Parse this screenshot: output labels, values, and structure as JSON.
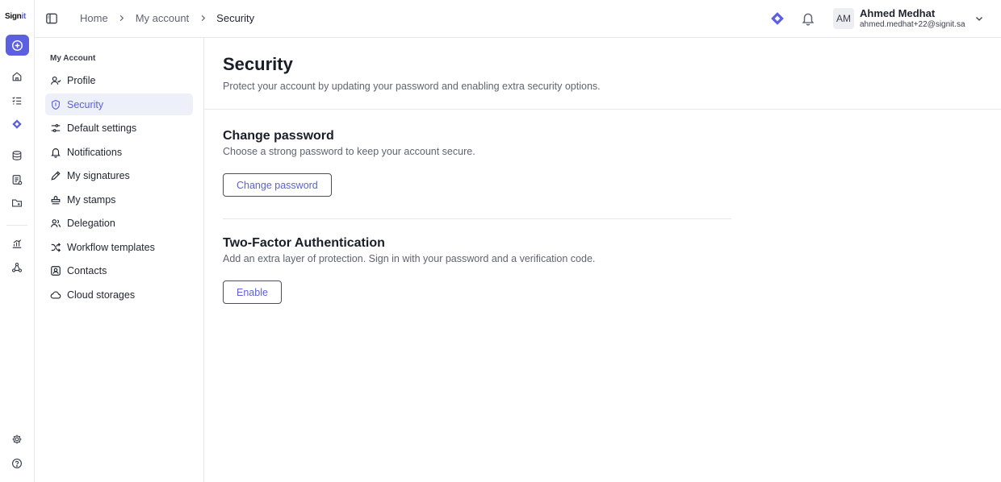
{
  "app": {
    "logo_text": "Sign",
    "logo_suffix": "it"
  },
  "rail": {
    "items": [
      {
        "icon": "plus-circle-icon"
      },
      {
        "icon": "home-icon"
      },
      {
        "icon": "task-list-icon"
      },
      {
        "icon": "diamond-icon"
      },
      {
        "icon": "archive-icon"
      },
      {
        "icon": "document-list-icon"
      },
      {
        "icon": "folder-share-icon"
      },
      {
        "icon": "analytics-icon"
      },
      {
        "icon": "workflow-icon"
      },
      {
        "icon": "settings-icon"
      },
      {
        "icon": "help-icon"
      }
    ]
  },
  "header": {
    "breadcrumbs": [
      "Home",
      "My account",
      "Security"
    ]
  },
  "user": {
    "initials": "AM",
    "name": "Ahmed Medhat",
    "email": "ahmed.medhat+22@signit.sa"
  },
  "account_nav": {
    "heading": "My Account",
    "items": [
      {
        "label": "Profile",
        "icon": "user-icon"
      },
      {
        "label": "Security",
        "icon": "shield-icon",
        "active": true
      },
      {
        "label": "Default settings",
        "icon": "sliders-icon"
      },
      {
        "label": "Notifications",
        "icon": "bell-icon"
      },
      {
        "label": "My signatures",
        "icon": "pen-icon"
      },
      {
        "label": "My stamps",
        "icon": "stamp-icon"
      },
      {
        "label": "Delegation",
        "icon": "users-icon"
      },
      {
        "label": "Workflow templates",
        "icon": "shuffle-icon"
      },
      {
        "label": "Contacts",
        "icon": "contact-icon"
      },
      {
        "label": "Cloud storages",
        "icon": "cloud-icon"
      }
    ]
  },
  "page": {
    "title": "Security",
    "subtitle": "Protect your account by updating your password and enabling extra security options."
  },
  "sections": {
    "password": {
      "title": "Change password",
      "description": "Choose a strong password to keep your account secure.",
      "button": "Change password"
    },
    "two_factor": {
      "title": "Two-Factor Authentication",
      "description": "Add an extra layer of protection. Sign in with your password and a verification code.",
      "button": "Enable"
    }
  },
  "colors": {
    "accent": "#5b5fe0",
    "border": "#e6e7eb",
    "active_bg": "#eef0f9"
  }
}
